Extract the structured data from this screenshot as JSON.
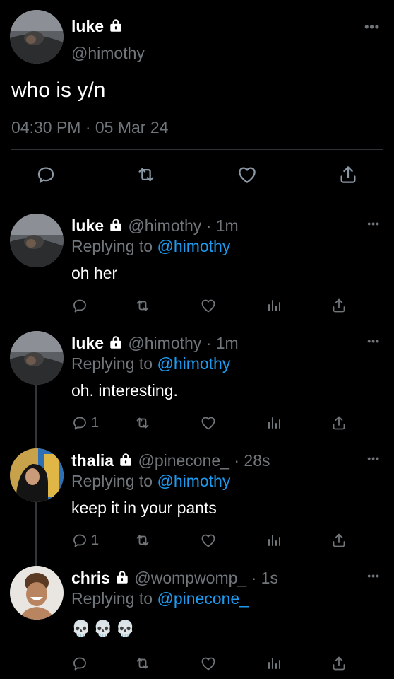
{
  "main_tweet": {
    "display_name": "luke",
    "handle": "@himothy",
    "text": "who is y/n",
    "timestamp": "04:30 PM · 05 Mar 24",
    "icons": [
      "lock-icon",
      "more-icon",
      "reply-icon",
      "retweet-icon",
      "like-icon",
      "share-icon"
    ]
  },
  "replies": [
    {
      "display_name": "luke",
      "handle": "@himothy",
      "time": "· 1m",
      "replying_prefix": "Replying to",
      "replying_to": "@himothy",
      "text": "oh her",
      "reply_count": ""
    },
    {
      "display_name": "luke",
      "handle": "@himothy",
      "time": "· 1m",
      "replying_prefix": "Replying to",
      "replying_to": "@himothy",
      "text": "oh. interesting.",
      "reply_count": "1"
    },
    {
      "display_name": "thalia",
      "handle": "@pinecone_",
      "time": "· 28s",
      "replying_prefix": "Replying to",
      "replying_to": "@himothy",
      "text": "keep it in your pants",
      "reply_count": "1"
    },
    {
      "display_name": "chris",
      "handle": "@wompwomp_",
      "time": "· 1s",
      "replying_prefix": "Replying to",
      "replying_to": "@pinecone_",
      "text": "💀💀💀",
      "reply_count": ""
    }
  ],
  "colors": {
    "background": "#000000",
    "muted": "#71767b",
    "link": "#1d9bf0",
    "divider": "#2f3336"
  }
}
